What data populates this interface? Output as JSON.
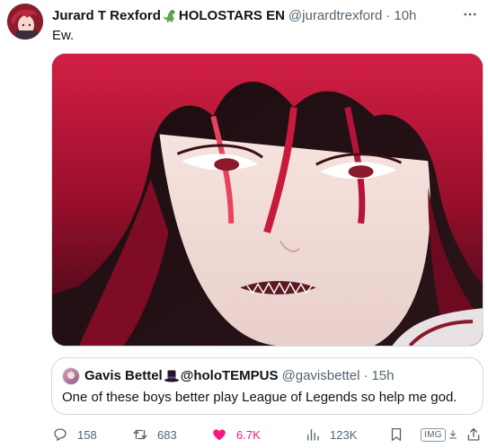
{
  "tweet": {
    "author": {
      "display_name": "Jurard T Rexford",
      "badge_emoji": "🦕",
      "affiliation": "HOLOSTARS EN",
      "handle": "@jurardtrexford",
      "separator": "·",
      "time": "10h"
    },
    "text": "Ew.",
    "more_icon": "more-horizontal-icon",
    "media": {
      "description_kind": "anime-illustration",
      "accent_color": "#b0123a"
    },
    "quote": {
      "display_name": "Gavis Bettel",
      "badge_emoji": "🎩",
      "affiliation": "@holoTEMPUS",
      "handle": "@gavisbettel",
      "separator": "·",
      "time": "15h",
      "text": "One of these boys better play League of Legends so help me god."
    },
    "actions": {
      "replies": "158",
      "retweets": "683",
      "likes": "6.7K",
      "views": "123K",
      "img_badge": "IMG",
      "like_color": "#f91880"
    }
  }
}
